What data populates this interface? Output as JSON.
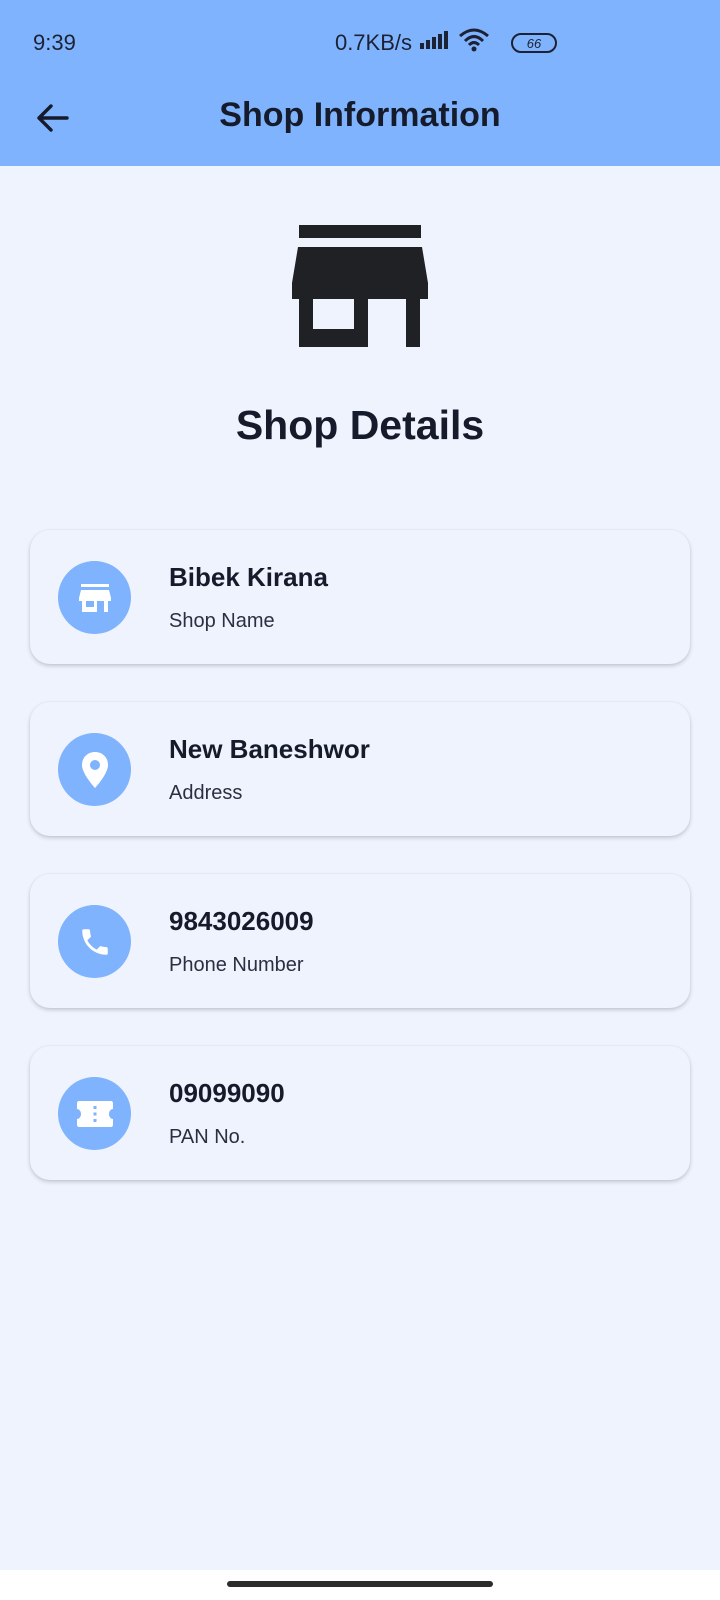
{
  "status_bar": {
    "time": "9:39",
    "network_speed": "0.7KB/s",
    "battery": "66",
    "icons": [
      "signal-icon",
      "wifi-icon",
      "battery-icon"
    ]
  },
  "app_bar": {
    "title": "Shop Information",
    "back_icon": "arrow-back-icon"
  },
  "header": {
    "icon": "storefront-icon",
    "title": "Shop Details"
  },
  "details": [
    {
      "value": "Bibek Kirana",
      "label": "Shop Name",
      "icon": "store-icon"
    },
    {
      "value": "New Baneshwor",
      "label": "Address",
      "icon": "location-pin-icon"
    },
    {
      "value": "9843026009",
      "label": "Phone Number",
      "icon": "phone-icon"
    },
    {
      "value": "09099090",
      "label": "PAN No.",
      "icon": "ticket-icon"
    }
  ],
  "colors": {
    "primary": "#7fb3fd",
    "background": "#eef3fd",
    "text": "#161b2c"
  }
}
